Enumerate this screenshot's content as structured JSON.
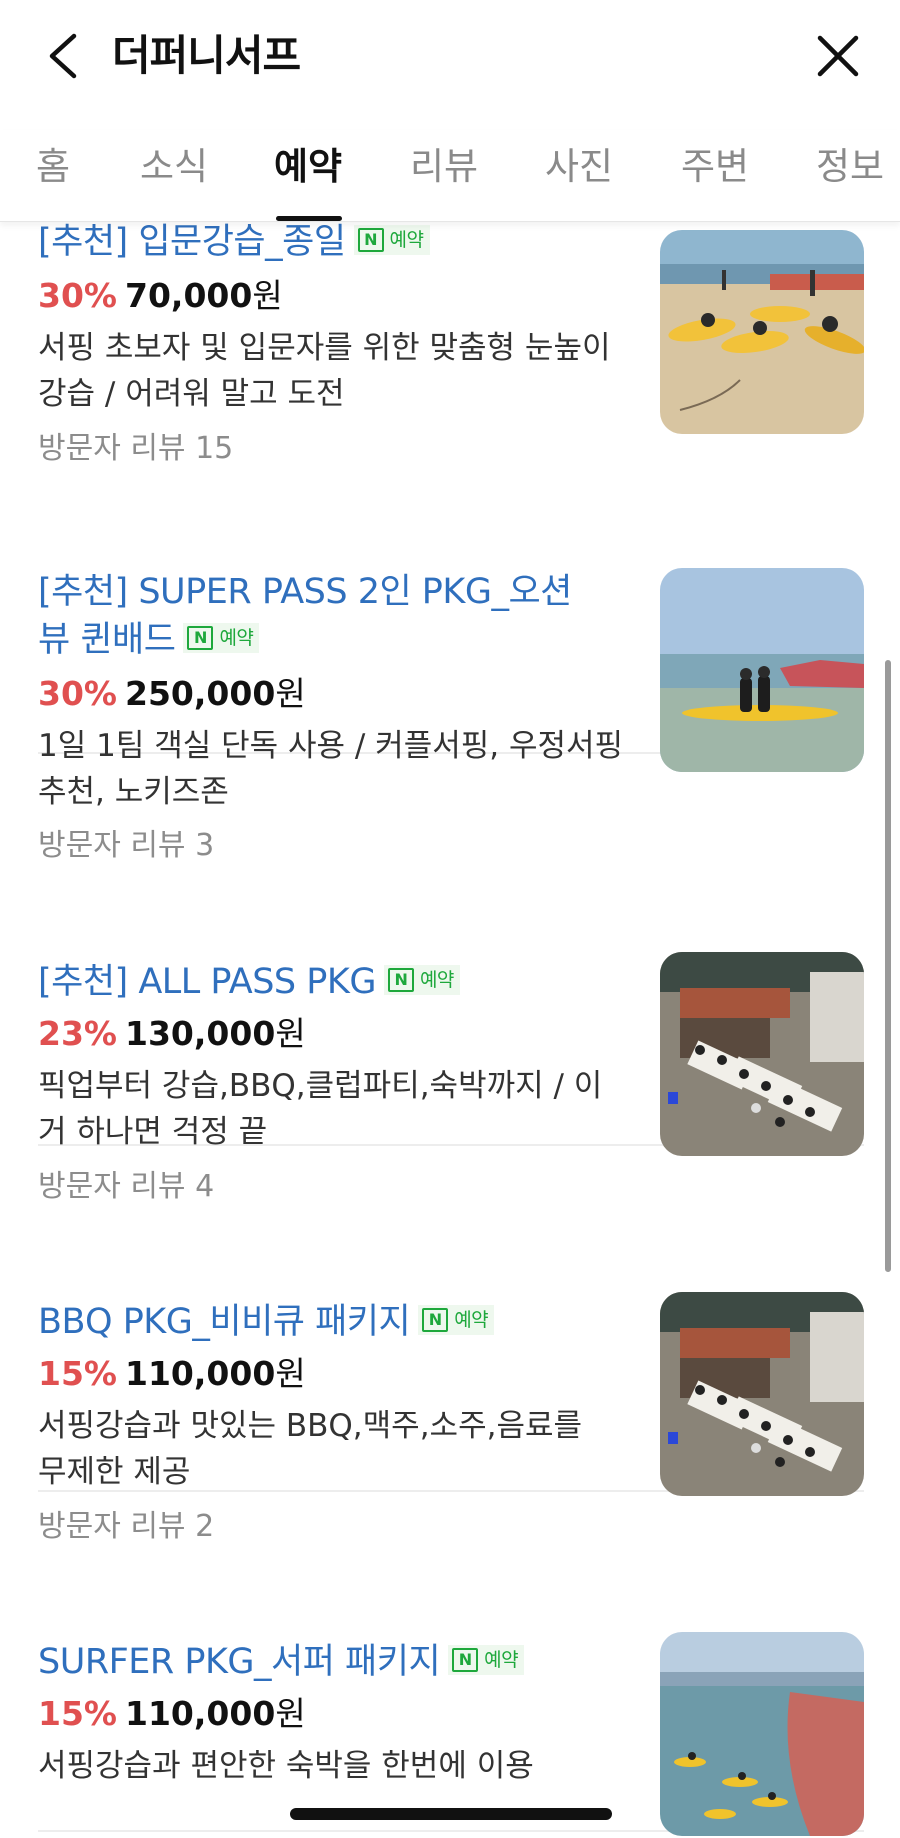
{
  "header": {
    "title": "더퍼니서프"
  },
  "tabs": [
    {
      "label": "홈"
    },
    {
      "label": "소식"
    },
    {
      "label": "예약"
    },
    {
      "label": "리뷰"
    },
    {
      "label": "사진"
    },
    {
      "label": "주변"
    },
    {
      "label": "정보"
    }
  ],
  "active_tab": "예약",
  "badge": {
    "n_label": "N",
    "text": "예약"
  },
  "items": [
    {
      "title": "[추천] 입문강습_종일",
      "discount": "30%",
      "price": "70,000",
      "currency": "원",
      "desc_line1": "서핑 초보자 및 입문자를 위한 맞춤형 눈높이",
      "desc_line2": "강습 / 어려워 말고 도전",
      "reviews": "방문자 리뷰 15"
    },
    {
      "title_line1": "[추천] SUPER PASS 2인 PKG_오션",
      "title_line2": "뷰 퀸배드",
      "discount": "30%",
      "price": "250,000",
      "currency": "원",
      "desc_line1": "1일 1팀 객실 단독 사용 / 커플서핑, 우정서핑",
      "desc_line2": "추천, 노키즈존",
      "reviews": "방문자 리뷰 3"
    },
    {
      "title": "[추천] ALL PASS PKG",
      "discount": "23%",
      "price": "130,000",
      "currency": "원",
      "desc_line1": "픽업부터 강습,BBQ,클럽파티,숙박까지 / 이",
      "desc_line2": "거 하나면 걱정 끝",
      "reviews": "방문자 리뷰 4"
    },
    {
      "title": "BBQ PKG_비비큐 패키지",
      "discount": "15%",
      "price": "110,000",
      "currency": "원",
      "desc_line1": "서핑강습과 맛있는 BBQ,맥주,소주,음료를",
      "desc_line2": "무제한 제공",
      "reviews": "방문자 리뷰 2"
    },
    {
      "title": "SURFER PKG_서퍼 패키지",
      "discount": "15%",
      "price": "110,000",
      "currency": "원",
      "desc_line1": "서핑강습과 편안한 숙박을 한번에 이용"
    }
  ],
  "colors": {
    "link_blue": "#2f6fbd",
    "discount_red": "#e05050",
    "naver_green": "#1ea83c"
  }
}
